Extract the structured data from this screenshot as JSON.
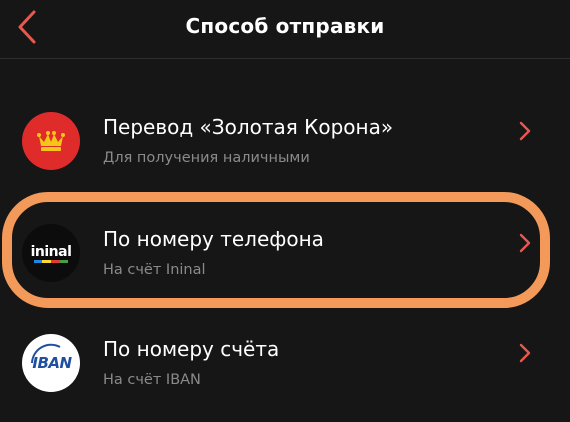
{
  "header": {
    "title": "Способ отправки"
  },
  "colors": {
    "accent": "#e8584f",
    "highlight": "#f39a5a"
  },
  "items": [
    {
      "icon": "golden-crown-logo",
      "title": "Перевод «Золотая Корона»",
      "subtitle": "Для получения наличными"
    },
    {
      "icon": "ininal-logo",
      "logo_text": "ininal",
      "title": "По номеру телефона",
      "subtitle": "На счёт Ininal",
      "highlighted": true
    },
    {
      "icon": "iban-logo",
      "logo_text": "IBAN",
      "title": "По номеру счёта",
      "subtitle": "На счёт IBAN"
    }
  ]
}
